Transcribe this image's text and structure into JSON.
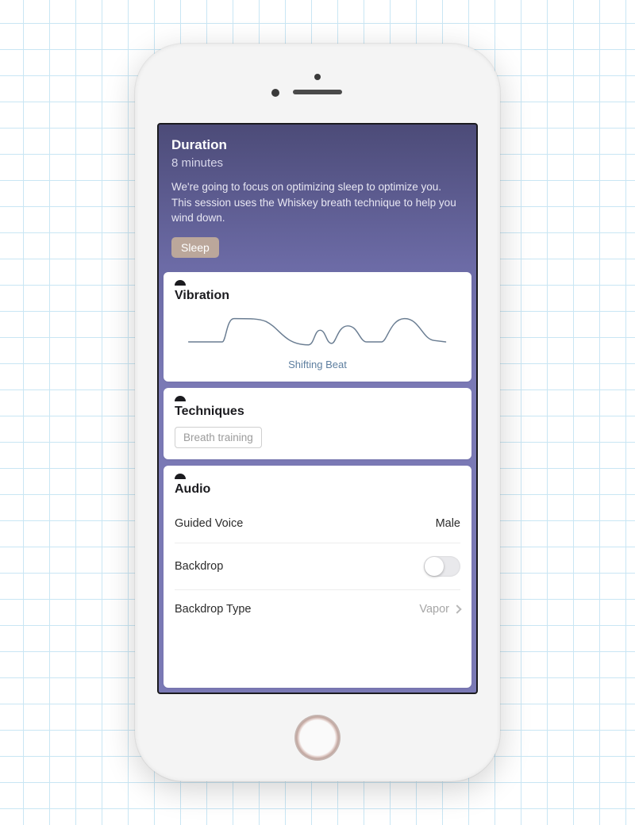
{
  "header": {
    "title": "Duration",
    "value": "8 minutes",
    "description": "We're going to focus on optimizing sleep to optimize you. This session uses the Whiskey breath technique to help you wind down.",
    "tag": "Sleep"
  },
  "vibration": {
    "title": "Vibration",
    "pattern_name": "Shifting Beat"
  },
  "techniques": {
    "title": "Techniques",
    "items": [
      "Breath training"
    ]
  },
  "audio": {
    "title": "Audio",
    "guided_voice": {
      "label": "Guided Voice",
      "value": "Male"
    },
    "backdrop": {
      "label": "Backdrop",
      "enabled": false
    },
    "backdrop_type": {
      "label": "Backdrop Type",
      "value": "Vapor"
    }
  }
}
